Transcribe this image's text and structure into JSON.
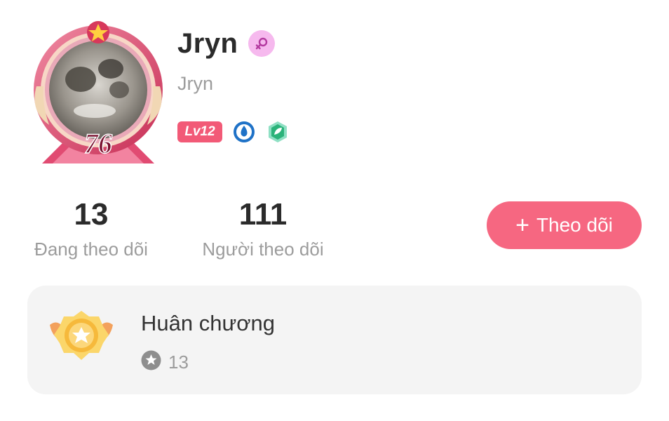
{
  "profile": {
    "display_name": "Jryn",
    "username": "Jryn",
    "gender_icon": "female-icon",
    "avatar_frame_number": "76",
    "level_badge": "Lv12",
    "badge_icons": [
      "water-drop-badge-icon",
      "leaf-badge-icon"
    ]
  },
  "stats": {
    "following_count": "13",
    "following_label": "Đang theo dõi",
    "followers_count": "111",
    "followers_label": "Người theo dõi"
  },
  "actions": {
    "follow_plus": "+",
    "follow_label": "Theo dõi"
  },
  "medals": {
    "title": "Huân chương",
    "count": "13"
  },
  "colors": {
    "accent": "#f66781",
    "level_badge": "#f25a77",
    "gender_bg": "#f6b9ee",
    "medal_card_bg": "#f4f4f4"
  }
}
